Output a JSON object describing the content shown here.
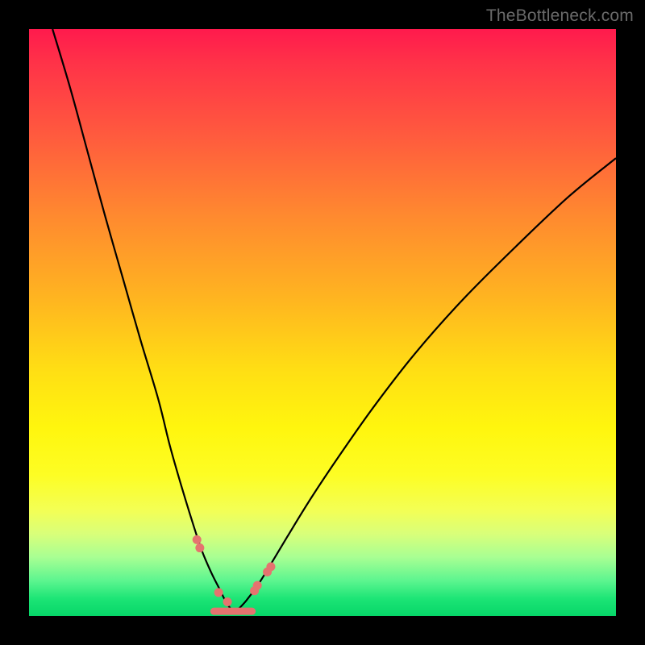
{
  "watermark": "TheBottleneck.com",
  "chart_data": {
    "type": "line",
    "title": "",
    "xlabel": "",
    "ylabel": "",
    "xlim": [
      0,
      100
    ],
    "ylim": [
      0,
      100
    ],
    "grid": false,
    "legend": false,
    "series": [
      {
        "name": "left-branch",
        "x": [
          4,
          7,
          10,
          13,
          16,
          19,
          22,
          24,
          26,
          28,
          29.5,
          31,
          32.5,
          33.5,
          34.5
        ],
        "values": [
          100,
          90,
          79,
          68,
          57.5,
          47,
          37,
          29,
          22,
          15.5,
          11,
          7.5,
          4.5,
          2.5,
          1.0
        ]
      },
      {
        "name": "right-branch",
        "x": [
          35.5,
          37,
          39,
          41,
          44,
          48,
          53,
          59,
          66,
          74,
          83,
          92,
          100
        ],
        "values": [
          1.0,
          2.6,
          5.3,
          8.5,
          13.5,
          20,
          27.5,
          36,
          45,
          54,
          63,
          71.5,
          78
        ]
      }
    ],
    "markers": {
      "name": "highlight-dots",
      "x": [
        28.6,
        29.1,
        32.3,
        33.8,
        38.4,
        38.9,
        40.6,
        41.2
      ],
      "values": [
        13.0,
        11.6,
        4.0,
        2.4,
        4.3,
        5.2,
        7.5,
        8.4
      ]
    },
    "baseline_segment": {
      "x_start": 31.5,
      "x_end": 38.0,
      "y": 0.8
    }
  }
}
